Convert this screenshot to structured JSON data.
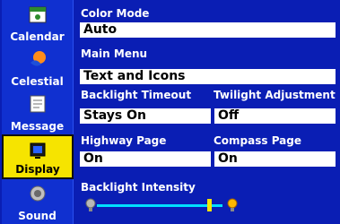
{
  "sidebar": {
    "items": [
      {
        "label": "Calendar",
        "icon": "calendar-icon"
      },
      {
        "label": "Celestial",
        "icon": "celestial-icon"
      },
      {
        "label": "Message",
        "icon": "message-icon"
      },
      {
        "label": "Display",
        "icon": "display-icon",
        "active": true
      },
      {
        "label": "Sound",
        "icon": "sound-icon"
      }
    ]
  },
  "settings": {
    "color_mode": {
      "label": "Color Mode",
      "value": "Auto"
    },
    "main_menu": {
      "label": "Main Menu",
      "value": "Text and Icons"
    },
    "backlight_timeout": {
      "label": "Backlight Timeout",
      "value": "Stays On"
    },
    "twilight_adjustment": {
      "label": "Twilight Adjustment",
      "value": "Off"
    },
    "highway_page": {
      "label": "Highway Page",
      "value": "On"
    },
    "compass_page": {
      "label": "Compass Page",
      "value": "On"
    },
    "backlight_intensity": {
      "label": "Backlight Intensity",
      "level": 0.9
    }
  },
  "colors": {
    "background": "#0a1eb4",
    "active_tab": "#f6e400",
    "slider_track": "#00e0ff"
  }
}
